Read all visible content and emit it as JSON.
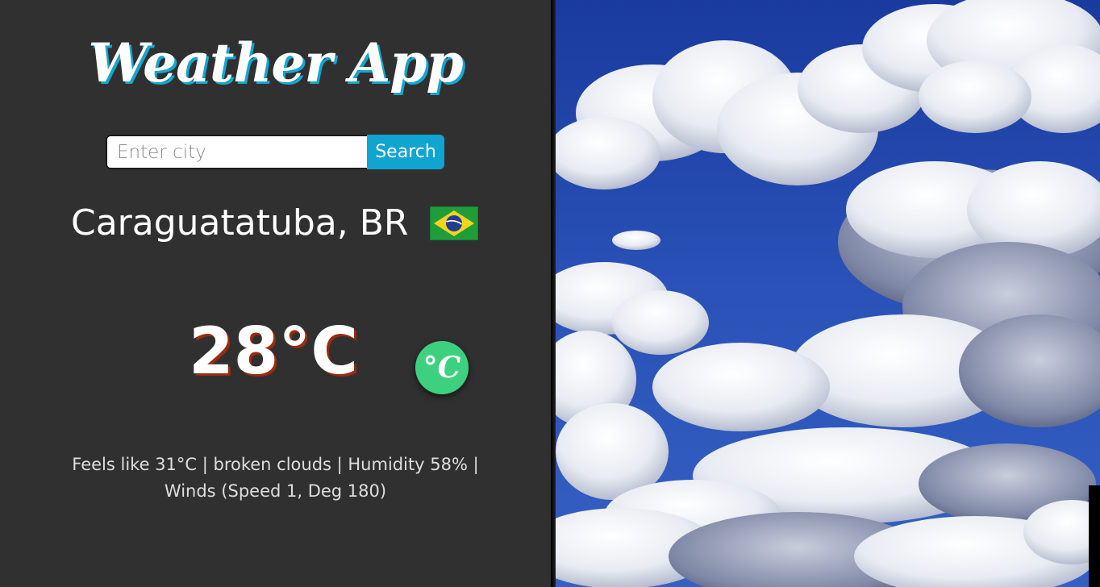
{
  "app": {
    "title": "Weather App"
  },
  "search": {
    "placeholder": "Enter city",
    "value": "",
    "button_label": "Search"
  },
  "location": {
    "city_label": "Caraguatatuba, BR",
    "flag_icon": "brazil-flag-icon"
  },
  "weather": {
    "temperature": "28°C",
    "unit_toggle_label": "°C",
    "details_line1": "Feels like 31°C | broken clouds | Humidity 58% |",
    "details_line2": "Winds (Speed 1, Deg 180)"
  },
  "colors": {
    "panel_bg": "#303030",
    "title_shadow": "#12a7d1",
    "search_button": "#10a5d0",
    "temp_shadow": "#9a2a10",
    "toggle_bg": "#3dd17f",
    "sky_blue": "#1f43a8"
  }
}
